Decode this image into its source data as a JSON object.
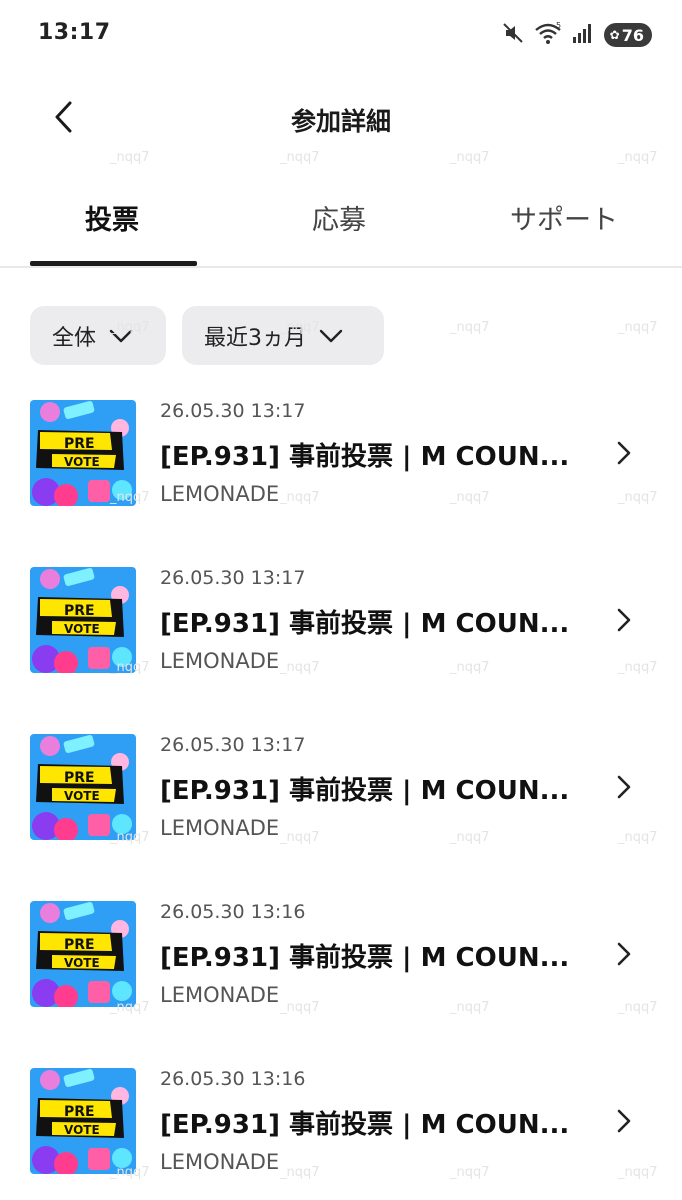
{
  "status_bar": {
    "time": "13:17",
    "battery_level": "76",
    "icons": [
      "mute-icon",
      "wifi-icon",
      "signal-icon",
      "battery-icon"
    ]
  },
  "header": {
    "title": "参加詳細"
  },
  "tabs": [
    {
      "label": "投票",
      "active": true
    },
    {
      "label": "応募",
      "active": false
    },
    {
      "label": "サポート",
      "active": false
    }
  ],
  "filters": {
    "scope": "全体",
    "period": "最近3ヵ月"
  },
  "items": [
    {
      "date": "26.05.30 13:17",
      "title": "[EP.931] 事前投票 | M COUN...",
      "artist": "LEMONADE",
      "thumb_line1": "PRE",
      "thumb_line2": "VOTE"
    },
    {
      "date": "26.05.30 13:17",
      "title": "[EP.931] 事前投票 | M COUN...",
      "artist": "LEMONADE",
      "thumb_line1": "PRE",
      "thumb_line2": "VOTE"
    },
    {
      "date": "26.05.30 13:17",
      "title": "[EP.931] 事前投票 | M COUN...",
      "artist": "LEMONADE",
      "thumb_line1": "PRE",
      "thumb_line2": "VOTE"
    },
    {
      "date": "26.05.30 13:16",
      "title": "[EP.931] 事前投票 | M COUN...",
      "artist": "LEMONADE",
      "thumb_line1": "PRE",
      "thumb_line2": "VOTE"
    },
    {
      "date": "26.05.30 13:16",
      "title": "[EP.931] 事前投票 | M COUN...",
      "artist": "LEMONADE",
      "thumb_line1": "PRE",
      "thumb_line2": "VOTE"
    }
  ],
  "watermark": "_nqq7",
  "colors": {
    "tab_indicator": "#1c1c1c",
    "chip_background": "#ececef",
    "thumb_background": "#2f9ff5",
    "thumb_banner": "#ffe600"
  }
}
